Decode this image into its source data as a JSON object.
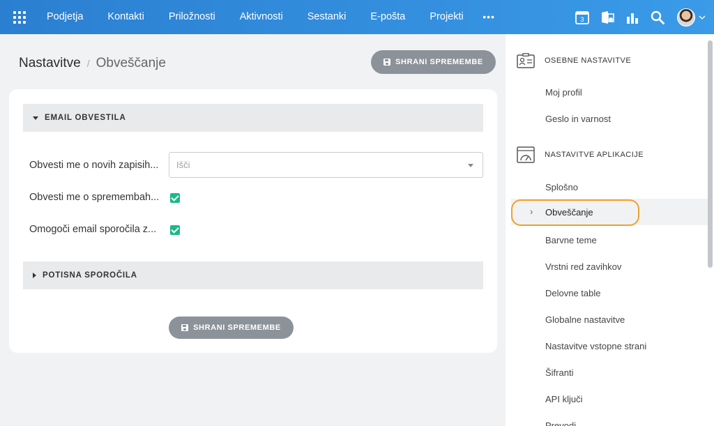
{
  "nav": {
    "items": [
      "Podjetja",
      "Kontakti",
      "Priložnosti",
      "Aktivnosti",
      "Sestanki",
      "E-pošta",
      "Projekti"
    ],
    "more": "•••",
    "calendar_day": "3"
  },
  "breadcrumb": {
    "root": "Nastavitve",
    "separator": "/",
    "current": "Obveščanje"
  },
  "save_label": "SHRANI SPREMEMBE",
  "sections": {
    "email": {
      "title": "EMAIL OBVESTILA",
      "rows": [
        {
          "label": "Obvesti me o novih zapisih...",
          "select_placeholder": "Išči"
        },
        {
          "label": "Obvesti me o spremembah...",
          "checked": true
        },
        {
          "label": "Omogoči email sporočila z...",
          "checked": true
        }
      ]
    },
    "push": {
      "title": "POTISNA SPOROČILA"
    }
  },
  "sidebar": {
    "personal": {
      "title": "OSEBNE NASTAVITVE",
      "items": [
        "Moj profil",
        "Geslo in varnost"
      ]
    },
    "apps": {
      "title": "NASTAVITVE APLIKACIJE",
      "items": [
        "Splošno",
        "Obveščanje",
        "Barvne teme",
        "Vrstni red zavihkov",
        "Delovne table",
        "Globalne nastavitve",
        "Nastavitve vstopne strani",
        "Šifranti",
        "API ključi",
        "Prevodi"
      ],
      "active": "Obveščanje",
      "active_chevron": "›"
    }
  },
  "colors": {
    "topbar": "#2b7fd1",
    "accent_green": "#1db889",
    "highlight": "#f0a12a",
    "button": "#8c9299"
  }
}
